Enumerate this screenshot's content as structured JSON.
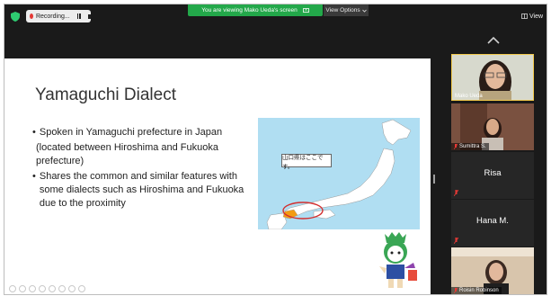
{
  "top_bar": {
    "recording_label": "Recording...",
    "viewing_text": "You are viewing Mako Ueda's screen",
    "view_options": "View Options",
    "view_label": "View"
  },
  "slide": {
    "title": "Yamaguchi Dialect",
    "bullet1": "Spoken in Yamaguchi prefecture in Japan",
    "paren": "(located between Hiroshima and Fukuoka prefecture)",
    "bullet2": "Shares the common and similar features with some dialects such as Hiroshima and Fukuoka due to the proximity",
    "map_label": "山口県はここです。"
  },
  "participants": [
    {
      "name": "Mako Ueda",
      "video": true
    },
    {
      "name": "Sumittra S.",
      "video": true
    },
    {
      "name": "Risa",
      "video": false
    },
    {
      "name": "Hana M.",
      "video": false
    },
    {
      "name": "Roisin Robinson",
      "video": true
    }
  ],
  "colors": {
    "viewing_bar": "#23a84a",
    "record_dot": "#e53935",
    "sea": "#b0def2",
    "highlight": "#d32f2f"
  }
}
